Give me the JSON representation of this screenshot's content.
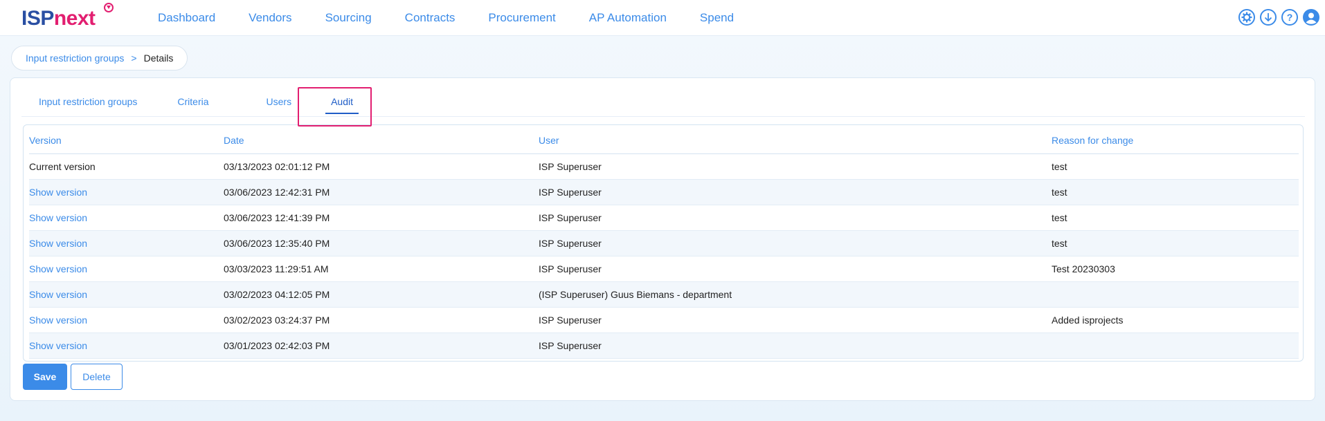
{
  "brand": {
    "part1": "ISP",
    "part2": "next"
  },
  "nav": {
    "items": [
      {
        "label": "Dashboard"
      },
      {
        "label": "Vendors"
      },
      {
        "label": "Sourcing"
      },
      {
        "label": "Contracts"
      },
      {
        "label": "Procurement"
      },
      {
        "label": "AP Automation"
      },
      {
        "label": "Spend"
      }
    ],
    "icons": [
      "gear-icon",
      "download-icon",
      "help-icon",
      "user-icon"
    ],
    "help_glyph": "?"
  },
  "breadcrumb": {
    "parent": "Input restriction groups",
    "separator": ">",
    "current": "Details"
  },
  "tabs": [
    {
      "label": "Input restriction groups"
    },
    {
      "label": "Criteria"
    },
    {
      "label": "Users"
    },
    {
      "label": "Audit",
      "active": true
    }
  ],
  "audit_table": {
    "headers": [
      "Version",
      "Date",
      "User",
      "Reason for change"
    ],
    "rows": [
      {
        "version": "Current version",
        "date": "03/13/2023 02:01:12 PM",
        "user": "ISP Superuser",
        "reason": "test"
      },
      {
        "version": "Show version",
        "date": "03/06/2023 12:42:31 PM",
        "user": "ISP Superuser",
        "reason": "test"
      },
      {
        "version": "Show version",
        "date": "03/06/2023 12:41:39 PM",
        "user": "ISP Superuser",
        "reason": "test"
      },
      {
        "version": "Show version",
        "date": "03/06/2023 12:35:40 PM",
        "user": "ISP Superuser",
        "reason": "test"
      },
      {
        "version": "Show version",
        "date": "03/03/2023 11:29:51 AM",
        "user": "ISP Superuser",
        "reason": "Test 20230303"
      },
      {
        "version": "Show version",
        "date": "03/02/2023 04:12:05 PM",
        "user": "(ISP Superuser) Guus Biemans - department",
        "reason": ""
      },
      {
        "version": "Show version",
        "date": "03/02/2023 03:24:37 PM",
        "user": "ISP Superuser",
        "reason": "Added isprojects"
      },
      {
        "version": "Show version",
        "date": "03/01/2023 02:42:03 PM",
        "user": "ISP Superuser",
        "reason": ""
      }
    ]
  },
  "actions": {
    "save_label": "Save",
    "delete_label": "Delete"
  },
  "colors": {
    "accent": "#3b8be8",
    "brand_pink": "#e21e70",
    "brand_navy": "#2a4fa3",
    "active_tab": "#1f5dc7"
  }
}
